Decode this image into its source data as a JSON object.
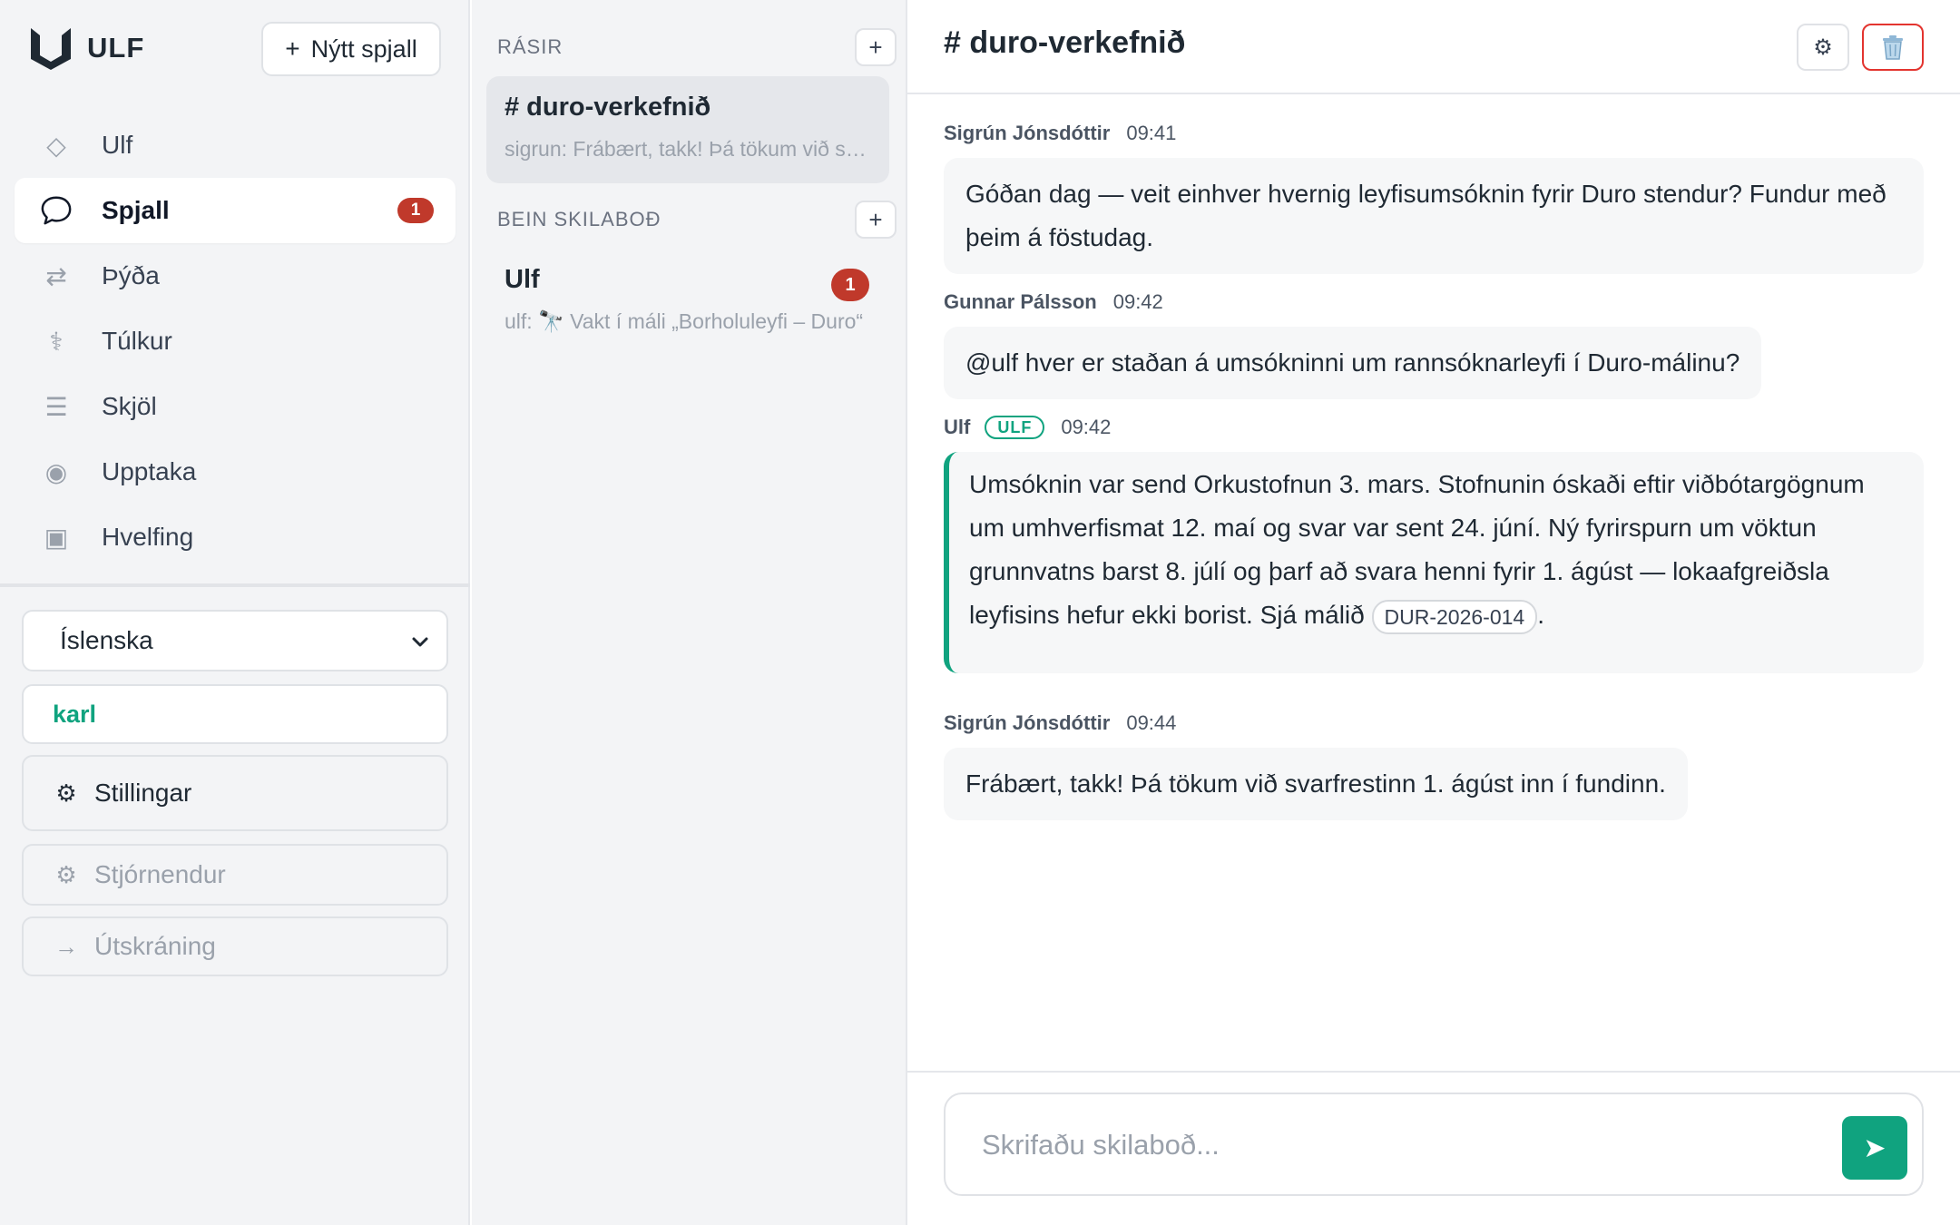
{
  "brand": {
    "name": "ULF",
    "accent": "#10a37f"
  },
  "sidebar": {
    "new_chat_label": "Nýtt spjall",
    "items": [
      {
        "label": "Ulf",
        "icon": "diamond-icon",
        "glyph": "◇",
        "active": false
      },
      {
        "label": "Spjall",
        "icon": "chat-bubble-icon",
        "glyph": "",
        "active": true,
        "badge": "1"
      },
      {
        "label": "Þýða",
        "icon": "swap-arrows-icon",
        "glyph": "⇄",
        "active": false
      },
      {
        "label": "Túlkur",
        "icon": "caduceus-icon",
        "glyph": "⚕",
        "active": false
      },
      {
        "label": "Skjöl",
        "icon": "list-icon",
        "glyph": "☰",
        "active": false
      },
      {
        "label": "Upptaka",
        "icon": "record-icon",
        "glyph": "◉",
        "active": false
      },
      {
        "label": "Hvelfing",
        "icon": "vault-icon",
        "glyph": "▣",
        "active": false
      }
    ],
    "language": "Íslenska",
    "user": "karl",
    "settings_label": "Stillingar",
    "admins_label": "Stjórnendur",
    "logout_label": "Útskráning"
  },
  "channels": {
    "rooms_title": "RÁSIR",
    "rooms": [
      {
        "name": "# duro-verkefnið",
        "preview": "sigrun: Frábært, takk! Þá tökum við svarfrestinn 1. ágúst inn í fundinn."
      }
    ],
    "dm_title": "BEIN SKILABOÐ",
    "dms": [
      {
        "name": "Ulf",
        "preview": "ulf: 🔭 Vakt í máli „Borholuleyfi – Duro“",
        "badge": "1"
      }
    ]
  },
  "chat": {
    "title": "# duro-verkefnið",
    "messages": [
      {
        "author": "Sigrún Jónsdóttir",
        "time": "09:41",
        "text": "Góðan dag — veit einhver hvernig leyfisumsóknin fyrir Duro stendur? Fundur með þeim á föstudag."
      },
      {
        "author": "Gunnar Pálsson",
        "time": "09:42",
        "text": "@ulf hver er staðan á umsókninni um rannsóknarleyfi í Duro-málinu?"
      },
      {
        "author": "Ulf",
        "tag": "ULF",
        "time": "09:42",
        "text": "Umsóknin var send Orkustofnun 3. mars. Stofnunin óskaði eftir viðbótargögnum um umhverfismat 12. maí og svar var sent 24. júní. Ný fyrirspurn um vöktun grunnvatns barst 8. júlí og þarf að svara henni fyrir 1. ágúst — lokaafgreiðsla leyfisins hefur ekki borist. Sjá málið",
        "case_ref": "DUR-2026-014",
        "text_end": "."
      },
      {
        "author": "Sigrún Jónsdóttir",
        "time": "09:44",
        "text": "Frábært, takk! Þá tökum við svarfrestinn 1. ágúst inn í fundinn."
      }
    ],
    "composer_placeholder": "Skrifaðu skilaboð..."
  }
}
